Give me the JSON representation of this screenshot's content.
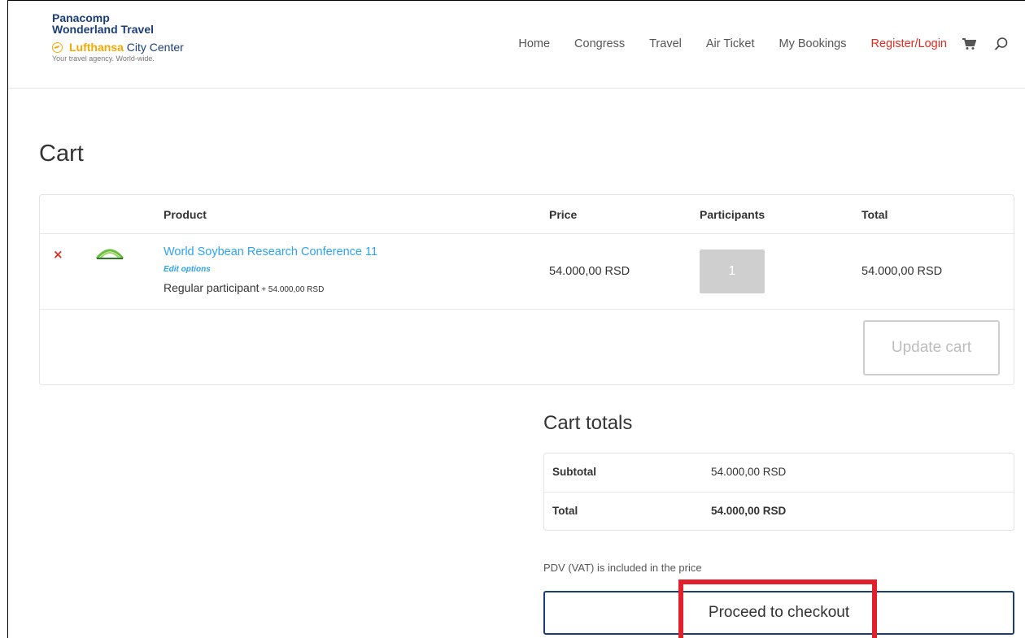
{
  "logo": {
    "line1": "Panacomp",
    "line2": "Wonderland Travel",
    "brand_bold": "Lufthansa",
    "brand_rest": " City Center",
    "tagline": "Your travel agency. World-wide."
  },
  "nav": {
    "items": [
      "Home",
      "Congress",
      "Travel",
      "Air Ticket",
      "My Bookings"
    ],
    "register_login": "Register/Login",
    "icons": [
      "cart-icon",
      "search-icon"
    ]
  },
  "page": {
    "title": "Cart"
  },
  "cart": {
    "headers": {
      "product": "Product",
      "price": "Price",
      "participants": "Participants",
      "total": "Total"
    },
    "item": {
      "remove": "×",
      "name": "World Soybean Research Conference 11",
      "edit": "Edit options",
      "variant": "Regular participant",
      "variant_price": " + 54.000,00 RSD",
      "price": "54.000,00 RSD",
      "quantity": "1",
      "total": "54.000,00 RSD"
    },
    "update_label": "Update cart"
  },
  "totals": {
    "title": "Cart totals",
    "subtotal_label": "Subtotal",
    "subtotal_value": "54.000,00 RSD",
    "total_label": "Total",
    "total_value": "54.000,00 RSD",
    "vat_note": "PDV (VAT) is included in the price",
    "checkout_label": "Proceed to checkout"
  },
  "colors": {
    "accent": "#2ea3f2",
    "register": "#e02b20",
    "brand_navy": "#1b3d7a",
    "highlight": "#e0202a"
  }
}
